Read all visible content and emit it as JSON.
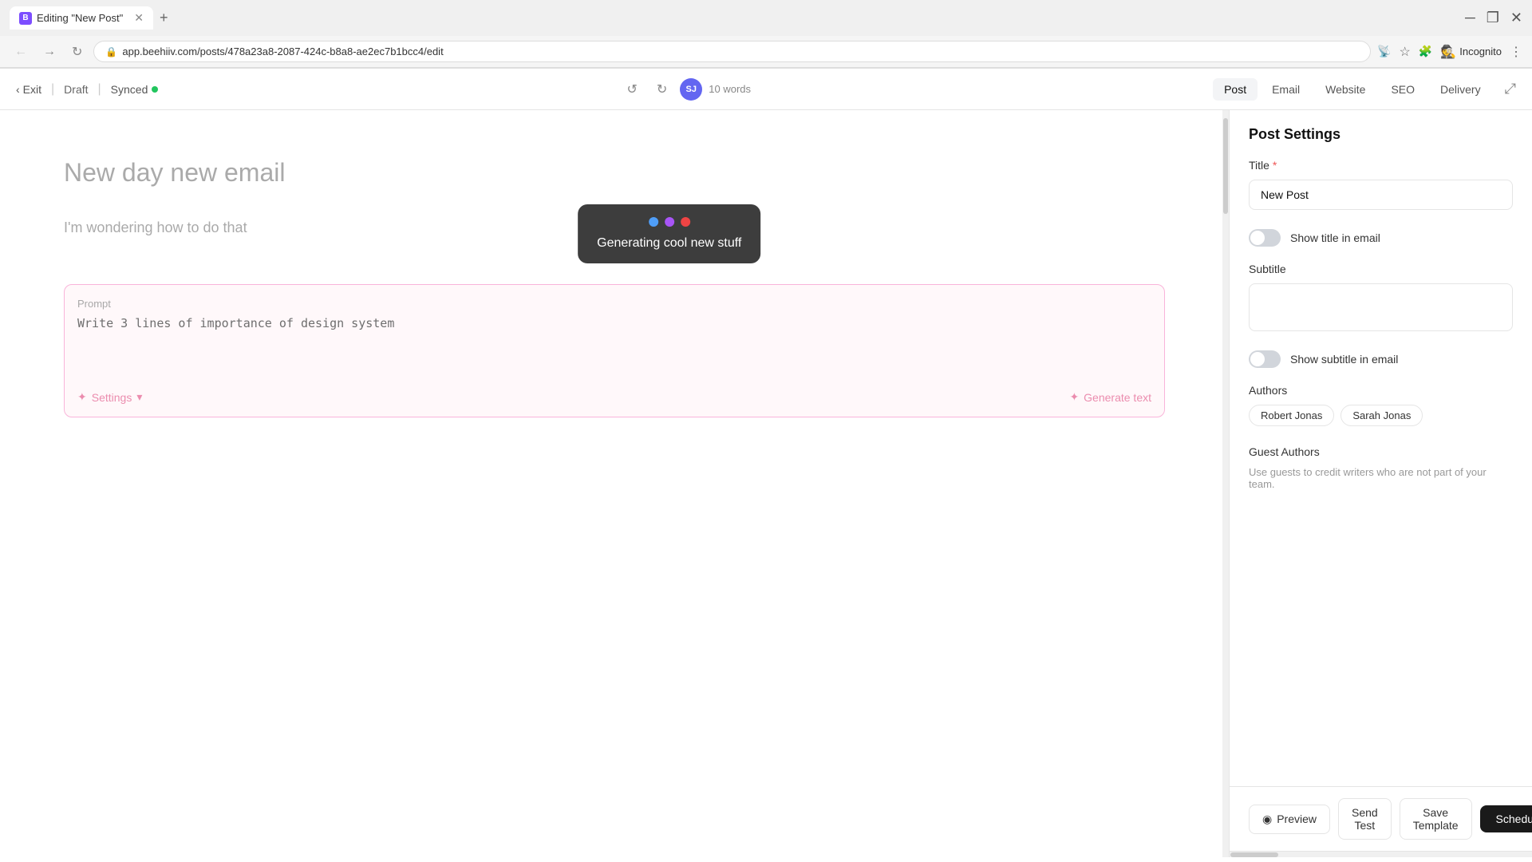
{
  "browser": {
    "tab_title": "Editing \"New Post\"",
    "url": "app.beehiiv.com/posts/478a23a8-2087-424c-b8a8-ae2ec7b1bcc4/edit",
    "incognito_label": "Incognito"
  },
  "toolbar": {
    "exit_label": "Exit",
    "draft_label": "Draft",
    "synced_label": "Synced",
    "undo_char": "↺",
    "redo_char": "↻",
    "author_initials": "SJ",
    "word_count": "10 words",
    "tabs": [
      "Post",
      "Email",
      "Website",
      "SEO",
      "Delivery"
    ]
  },
  "editor": {
    "post_title": "New day new email",
    "post_subtitle": "I'm wondering how to do that"
  },
  "ai_widget": {
    "generating_text": "Generating cool new stuff",
    "prompt_label": "Prompt",
    "prompt_value": "Write 3 lines of importance of design system",
    "settings_label": "Settings",
    "generate_label": "Generate text"
  },
  "right_panel": {
    "title": "Post Settings",
    "title_label": "Title",
    "title_required": "*",
    "title_value": "New Post",
    "show_title_label": "Show title in email",
    "subtitle_label": "Subtitle",
    "show_subtitle_label": "Show subtitle in email",
    "authors_label": "Authors",
    "authors": [
      "Robert Jonas",
      "Sarah Jonas"
    ],
    "guest_authors_label": "Guest Authors",
    "guest_description": "Use guests to credit writers who are not part of your team."
  },
  "bottom_bar": {
    "preview_label": "Preview",
    "send_test_label": "Send Test",
    "save_template_label": "Save Template",
    "schedule_label": "Schedule"
  },
  "icons": {
    "back_arrow": "←",
    "lock": "🔒",
    "star": "☆",
    "settings_icon": "⊞",
    "eye_icon": "◉",
    "spark_icon": "✦",
    "chevron_down": "▾",
    "expand": "⤢"
  }
}
